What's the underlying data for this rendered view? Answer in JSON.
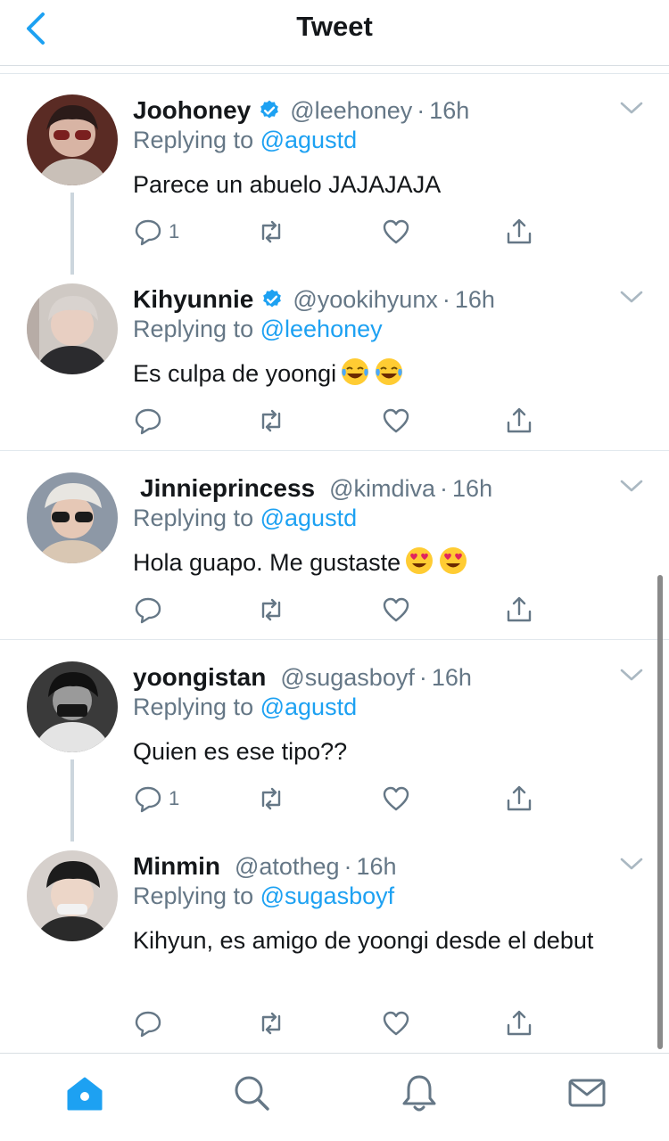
{
  "header": {
    "title": "Tweet"
  },
  "colors": {
    "accent": "#1da1f2",
    "secondary_text": "#657786"
  },
  "tweets": [
    {
      "display_name": "Joohoney",
      "verified": true,
      "handle": "@leehoney",
      "separator": "·",
      "time": "16h",
      "replying_prefix": "Replying to",
      "replying_to": "@agustd",
      "text": "Parece un abuelo JAJAJAJA",
      "reply_count": "1"
    },
    {
      "display_name": "Kihyunnie",
      "verified": true,
      "handle": "@yookihyunx",
      "separator": "·",
      "time": "16h",
      "replying_prefix": "Replying to",
      "replying_to": "@leehoney",
      "text": "Es culpa de yoongi",
      "emojis": [
        "laughing-tears-emoji",
        "laughing-tears-emoji"
      ],
      "reply_count": ""
    },
    {
      "display_name": "Jinnieprincess",
      "verified": false,
      "handle": "@kimdiva",
      "separator": "·",
      "time": "16h",
      "replying_prefix": "Replying to",
      "replying_to": "@agustd",
      "text": "Hola guapo. Me gustaste",
      "emojis": [
        "heart-eyes-emoji",
        "heart-eyes-emoji"
      ],
      "reply_count": ""
    },
    {
      "display_name": "yoongistan",
      "verified": false,
      "handle": "@sugasboyf",
      "separator": "·",
      "time": "16h",
      "replying_prefix": "Replying to",
      "replying_to": "@agustd",
      "text": "Quien es ese tipo??",
      "reply_count": "1"
    },
    {
      "display_name": "Minmin",
      "verified": false,
      "handle": "@atotheg",
      "separator": "·",
      "time": "16h",
      "replying_prefix": "Replying to",
      "replying_to": "@sugasboyf",
      "text": "Kihyun, es amigo de yoongi desde el debut",
      "reply_count": ""
    }
  ],
  "tabbar": {
    "tabs": [
      "home-icon",
      "search-icon",
      "notifications-bell-icon",
      "messages-mail-icon"
    ],
    "active": "home-icon"
  }
}
